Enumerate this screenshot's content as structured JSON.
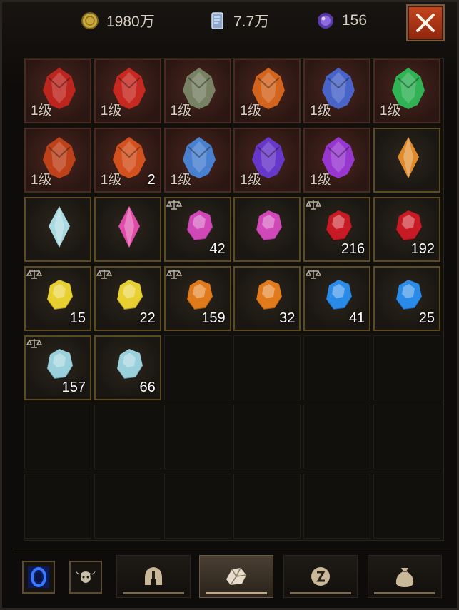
{
  "header": {
    "gold": {
      "icon": "gold-coin-icon",
      "value": "1980万"
    },
    "silver": {
      "icon": "silver-card-icon",
      "value": "7.7万"
    },
    "orb": {
      "icon": "purple-orb-icon",
      "value": "156"
    },
    "close": {
      "icon": "close-icon"
    }
  },
  "inventory": {
    "rows": [
      [
        {
          "name": "red-dragon-essence",
          "level": "1级",
          "color": "#c8261f"
        },
        {
          "name": "crimson-demon-heart",
          "level": "1级",
          "color": "#d22a22"
        },
        {
          "name": "serpent-eye",
          "level": "1级",
          "color": "#7d8a6a"
        },
        {
          "name": "flame-heart",
          "level": "1级",
          "color": "#e06a1e"
        },
        {
          "name": "azure-mask",
          "level": "1级",
          "color": "#4a6ad8"
        },
        {
          "name": "emerald-crystal",
          "level": "1级",
          "color": "#2fbf5a"
        }
      ],
      [
        {
          "name": "obsidian-fire-egg",
          "level": "1级",
          "color": "#c9441a"
        },
        {
          "name": "magma-stone",
          "level": "1级",
          "count": "2",
          "color": "#e0561e"
        },
        {
          "name": "blue-soul-crystal",
          "level": "1级",
          "color": "#4a8ae0"
        },
        {
          "name": "void-orb",
          "level": "1级",
          "color": "#6a3ad8"
        },
        {
          "name": "amethyst-cluster",
          "level": "1级",
          "color": "#a03ae0"
        },
        {
          "name": "amber-shard",
          "color": "#e08a2a"
        }
      ],
      [
        {
          "name": "diamond-shard",
          "color": "#a8d8e0"
        },
        {
          "name": "pink-gem-drop",
          "color": "#e04aa8"
        },
        {
          "name": "amethyst-gem",
          "count": "42",
          "color": "#d048b8",
          "tradeable": true
        },
        {
          "name": "amethyst-gem",
          "color": "#d048b8"
        },
        {
          "name": "ruby-gem",
          "count": "216",
          "color": "#c81a24",
          "tradeable": true
        },
        {
          "name": "ruby-gem",
          "count": "192",
          "color": "#c81a24"
        }
      ],
      [
        {
          "name": "topaz-gem",
          "count": "15",
          "color": "#e8d030",
          "tradeable": true
        },
        {
          "name": "topaz-gem",
          "count": "22",
          "color": "#e8d030",
          "tradeable": true
        },
        {
          "name": "amber-gem",
          "count": "159",
          "color": "#e07a1a",
          "tradeable": true
        },
        {
          "name": "amber-gem",
          "count": "32",
          "color": "#e07a1a"
        },
        {
          "name": "sapphire-gem",
          "count": "41",
          "color": "#2a8ae8",
          "tradeable": true
        },
        {
          "name": "sapphire-gem",
          "count": "25",
          "color": "#2a8ae8"
        }
      ],
      [
        {
          "name": "diamond-gem",
          "count": "157",
          "color": "#9ad0dc",
          "tradeable": true
        },
        {
          "name": "diamond-gem",
          "count": "66",
          "color": "#9ad0dc"
        }
      ]
    ]
  },
  "bottom_bar": {
    "buttons": [
      {
        "icon": "blue-portal-icon"
      },
      {
        "icon": "bull-demon-icon"
      }
    ],
    "tabs": [
      {
        "icon": "helmet-icon",
        "active": false
      },
      {
        "icon": "gem-tab-icon",
        "active": true
      },
      {
        "icon": "rune-icon",
        "active": false
      },
      {
        "icon": "bag-icon",
        "active": false
      }
    ]
  }
}
